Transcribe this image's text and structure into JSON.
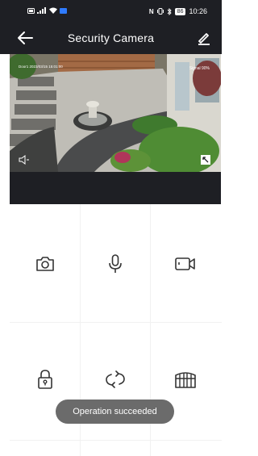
{
  "status_bar": {
    "time": "10:26",
    "battery": "86",
    "left_icons": [
      "sim-icon",
      "signal-icon",
      "wifi-icon",
      "message-icon"
    ],
    "right_icons": [
      "nfc-icon",
      "vibrate-icon",
      "bluetooth-icon",
      "battery-icon"
    ]
  },
  "header": {
    "title": "Security Camera"
  },
  "video": {
    "camera_name_timestamp": "Door1  2023/03/15  15:01:00",
    "signal": "Signal 90%"
  },
  "controls": [
    {
      "icon": "camera-icon",
      "name": "snapshot-button"
    },
    {
      "icon": "microphone-icon",
      "name": "talk-button"
    },
    {
      "icon": "video-record-icon",
      "name": "record-button"
    },
    {
      "icon": "lock-icon",
      "name": "unlock-button"
    },
    {
      "icon": "rotate-icon",
      "name": "rotate-button"
    },
    {
      "icon": "gate-icon",
      "name": "gate-button"
    }
  ],
  "toast": {
    "message": "Operation succeeded"
  },
  "colors": {
    "header_bg": "#1e1f24",
    "toast_bg": "#6b6b6b",
    "icon": "#333333"
  }
}
